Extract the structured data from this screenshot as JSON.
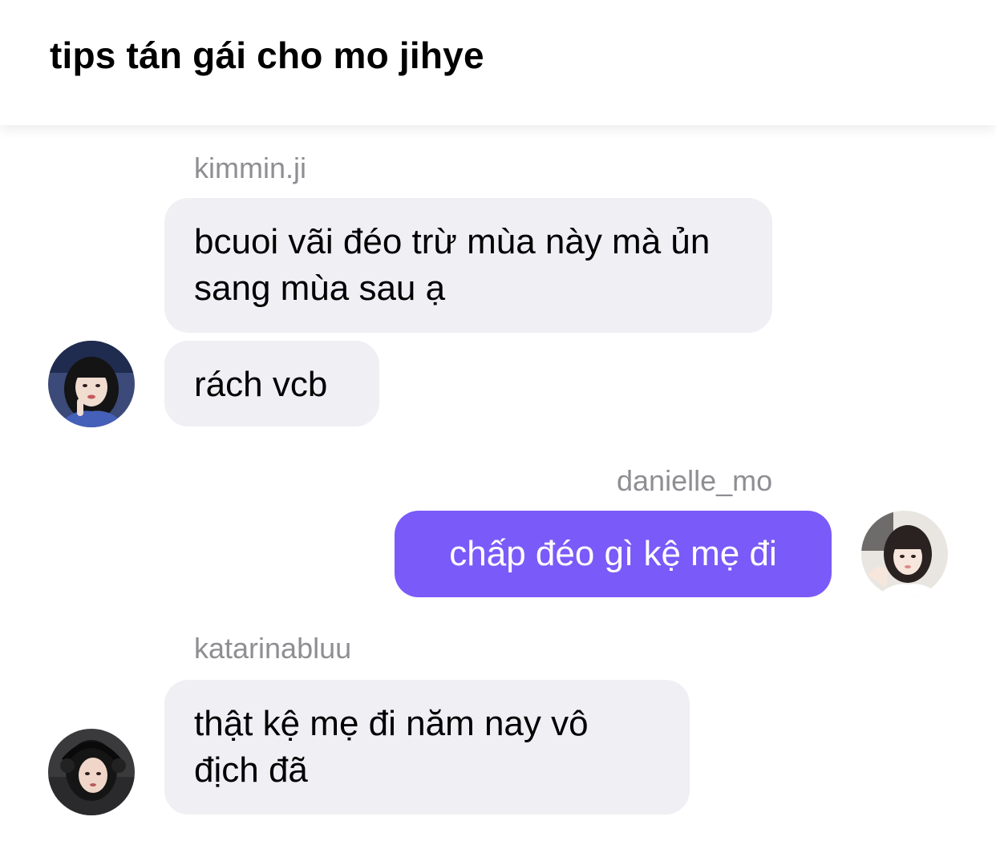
{
  "header": {
    "title": "tips tán gái cho mo jihye"
  },
  "messages": [
    {
      "sender": "kimmin.ji",
      "bubbles": [
        "bcuoi vãi đéo trừ mùa này mà ủn sang mùa sau ạ",
        "rách vcb"
      ],
      "avatar_icon": "profile-photo-kimmin-ji",
      "side": "left"
    },
    {
      "sender": "danielle_mo",
      "bubbles": [
        "chấp đéo gì kệ mẹ đi"
      ],
      "avatar_icon": "profile-photo-danielle-mo",
      "side": "right"
    },
    {
      "sender": "katarinabluu",
      "bubbles": [
        "thật kệ mẹ đi năm nay vô địch đã"
      ],
      "avatar_icon": "profile-photo-katarinabluu",
      "side": "left"
    }
  ],
  "colors": {
    "incoming_bubble": "#efeff4",
    "outgoing_bubble": "#7a5af8",
    "sender_name": "#8e8e93",
    "background": "#ffffff"
  }
}
